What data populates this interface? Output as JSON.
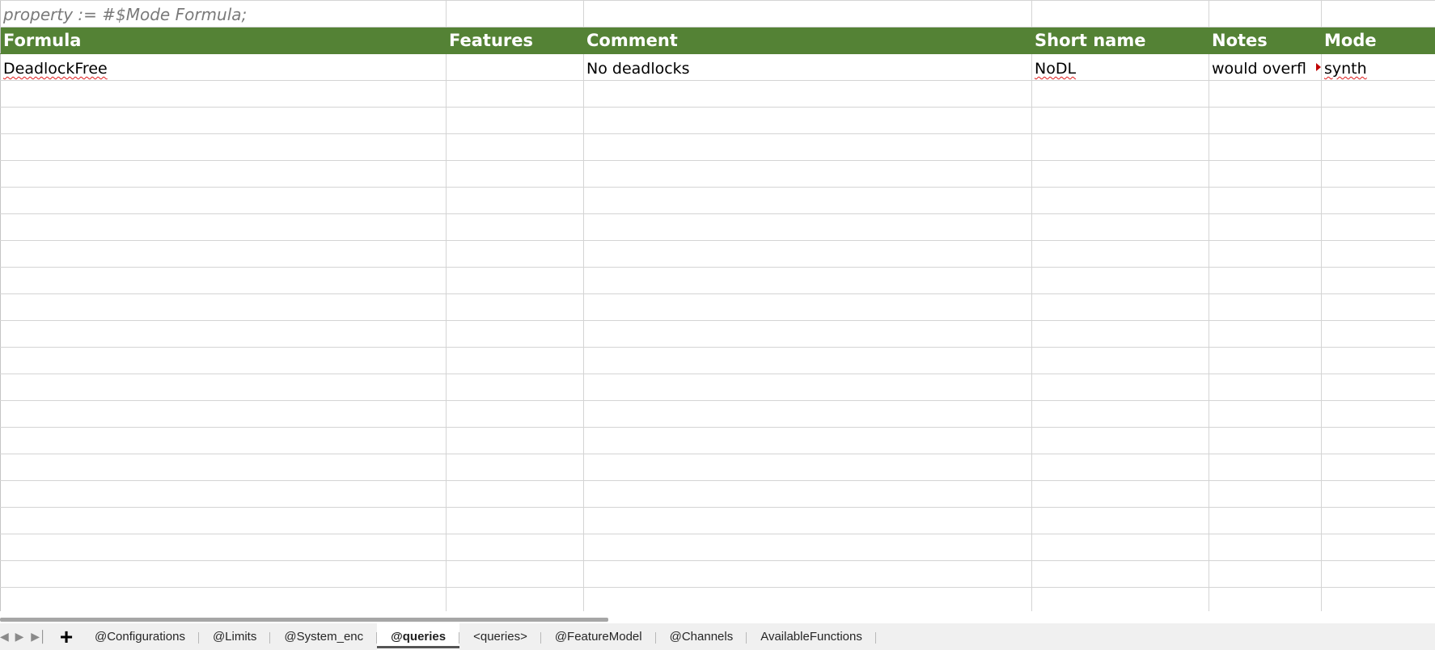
{
  "sheet": {
    "top_note": "property := #$Mode Formula;",
    "columns": [
      "Formula",
      "Features",
      "Comment",
      "Short name",
      "Notes",
      "Mode"
    ],
    "rows": [
      [
        "DeadlockFree",
        "",
        "No deadlocks",
        "NoDL",
        "would overfl",
        "synth"
      ]
    ],
    "header_color": "#548235"
  },
  "tabs": {
    "items": [
      "@Configurations",
      "@Limits",
      "@System_enc",
      "@queries",
      "<queries>",
      "@FeatureModel",
      "@Channels",
      "AvailableFunctions"
    ],
    "active": "@queries",
    "add_label": "+",
    "prev_icon": "triangle-left-icon",
    "next_icon": "triangle-right-icon",
    "last_icon": "triangle-right-end-icon"
  }
}
